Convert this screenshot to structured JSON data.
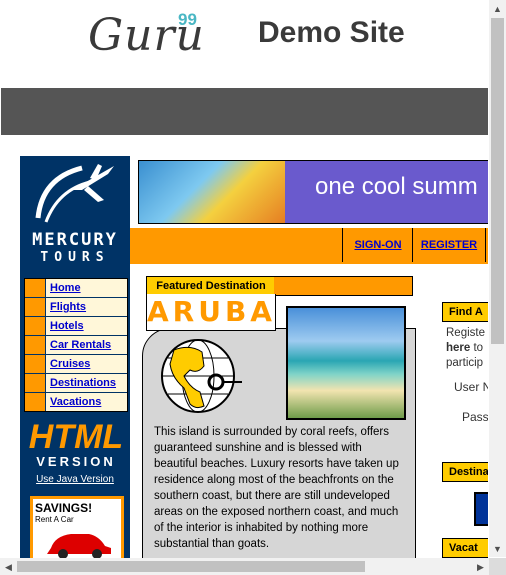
{
  "top_banner": {
    "brand": "Guru",
    "brand_superscript": "99",
    "subtitle": "Demo Site"
  },
  "site": {
    "logo": {
      "line1": "MERCURY",
      "line2": "TOURS"
    },
    "nav": [
      "Home",
      "Flights",
      "Hotels",
      "Car Rentals",
      "Cruises",
      "Destinations",
      "Vacations"
    ],
    "html_version": {
      "big": "HTML",
      "small": "VERSION",
      "link": "Use Java Version"
    },
    "savings_ad": {
      "title": "SAVINGS!",
      "subtitle": "Rent A Car"
    },
    "banner_text": "one cool summ",
    "tabs": [
      "SIGN-ON",
      "REGISTER"
    ],
    "featured": {
      "header": "Featured Destination",
      "name": "ARUBA",
      "description": "This island is surrounded by coral reefs, offers guaranteed sunshine and is blessed with beautiful beaches. Luxury resorts have taken up residence along most of the beachfronts on the southern coast, but there are still undeveloped areas on the exposed northern coast, and much of the interior is inhabited by nothing more substantial than goats."
    },
    "right": {
      "find_header": "Find A",
      "reg_line1": "Registe",
      "reg_line2_bold": "here",
      "reg_line2_rest": " to",
      "reg_line3": "particip",
      "user_label": "User N",
      "pass_label": "Pass",
      "dest_header": "Destina",
      "vac_header": "Vacat"
    }
  },
  "scrollbars": {
    "up": "▲",
    "down": "▼",
    "left": "◀",
    "right": "▶"
  },
  "colors": {
    "nav_blue": "#003366",
    "orange": "#ff9900",
    "yellow": "#ffcc00",
    "link": "#0000cc"
  }
}
